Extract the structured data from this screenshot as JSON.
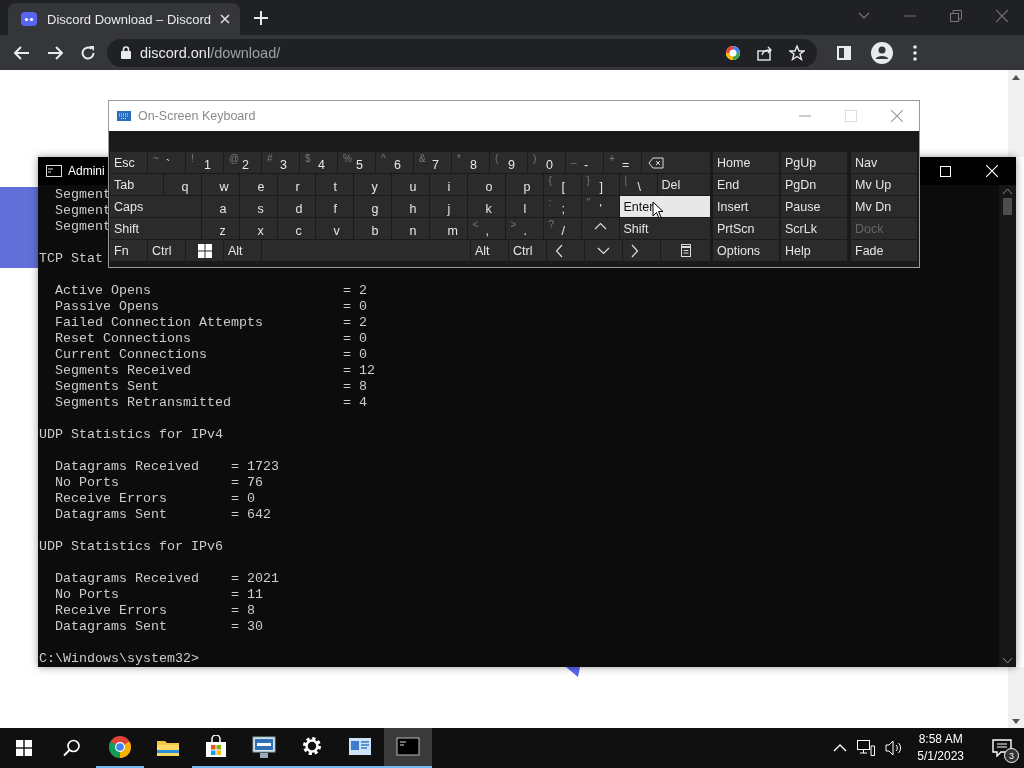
{
  "browser": {
    "tab": {
      "title": "Discord Download – Discord"
    },
    "address": {
      "host": "discord.onl",
      "path": "/download/"
    }
  },
  "console": {
    "title": "Admini",
    "blocks": [
      [
        "  Segment",
        "  Segment",
        "  Segment"
      ],
      [
        "TCP Stat"
      ],
      [
        "  Active Opens                        = 2",
        "  Passive Opens                       = 0",
        "  Failed Connection Attempts          = 2",
        "  Reset Connections                   = 0",
        "  Current Connections                 = 0",
        "  Segments Received                   = 12",
        "  Segments Sent                       = 8",
        "  Segments Retransmitted              = 4"
      ],
      [
        "UDP Statistics for IPv4"
      ],
      [
        "  Datagrams Received    = 1723",
        "  No Ports              = 76",
        "  Receive Errors        = 0",
        "  Datagrams Sent        = 642"
      ],
      [
        "UDP Statistics for IPv6"
      ],
      [
        "  Datagrams Received    = 2021",
        "  No Ports              = 11",
        "  Receive Errors        = 8",
        "  Datagrams Sent        = 30"
      ],
      [
        "C:\\Windows\\system32>"
      ]
    ]
  },
  "keyboard": {
    "title": "On-Screen Keyboard",
    "rows": [
      {
        "keys": [
          {
            "kind": "label",
            "label": "Esc",
            "hovered": false
          },
          {
            "kind": "char",
            "shift": "~",
            "label": "`",
            "hovered": false
          },
          {
            "kind": "char",
            "shift": "!",
            "label": "1",
            "hovered": false
          },
          {
            "kind": "char",
            "shift": "@",
            "label": "2",
            "hovered": false
          },
          {
            "kind": "char",
            "shift": "#",
            "label": "3",
            "hovered": false
          },
          {
            "kind": "char",
            "shift": "$",
            "label": "4",
            "hovered": false
          },
          {
            "kind": "char",
            "shift": "%",
            "label": "5",
            "hovered": false
          },
          {
            "kind": "char",
            "shift": "^",
            "label": "6",
            "hovered": false
          },
          {
            "kind": "char",
            "shift": "&",
            "label": "7",
            "hovered": false
          },
          {
            "kind": "char",
            "shift": "*",
            "label": "8",
            "hovered": false
          },
          {
            "kind": "char",
            "shift": "(",
            "label": "9",
            "hovered": false
          },
          {
            "kind": "char",
            "shift": ")",
            "label": "0",
            "hovered": false
          },
          {
            "kind": "char",
            "shift": "_",
            "label": "-",
            "hovered": false
          },
          {
            "kind": "char",
            "shift": "+",
            "label": "=",
            "hovered": false
          },
          {
            "kind": "backspace",
            "hovered": false
          }
        ]
      },
      {
        "keys": [
          {
            "kind": "wide",
            "label": "Tab",
            "hovered": false
          },
          {
            "kind": "char",
            "label": "q",
            "hovered": false
          },
          {
            "kind": "char",
            "label": "w",
            "hovered": false
          },
          {
            "kind": "char",
            "label": "e",
            "hovered": false
          },
          {
            "kind": "char",
            "label": "r",
            "hovered": false
          },
          {
            "kind": "char",
            "label": "t",
            "hovered": false
          },
          {
            "kind": "char",
            "label": "y",
            "hovered": false
          },
          {
            "kind": "char",
            "label": "u",
            "hovered": false
          },
          {
            "kind": "char",
            "label": "i",
            "hovered": false
          },
          {
            "kind": "char",
            "label": "o",
            "hovered": false
          },
          {
            "kind": "char",
            "label": "p",
            "hovered": false
          },
          {
            "kind": "char",
            "shift": "{",
            "label": "[",
            "hovered": false
          },
          {
            "kind": "char",
            "shift": "}",
            "label": "]",
            "hovered": false
          },
          {
            "kind": "char",
            "shift": "|",
            "label": "\\",
            "hovered": false
          },
          {
            "kind": "wide",
            "label": "Del",
            "hovered": false
          }
        ]
      },
      {
        "keys": [
          {
            "kind": "wide",
            "label": "Caps",
            "hovered": false
          },
          {
            "kind": "char",
            "label": "a",
            "hovered": false
          },
          {
            "kind": "char",
            "label": "s",
            "hovered": false
          },
          {
            "kind": "char",
            "label": "d",
            "hovered": false
          },
          {
            "kind": "char",
            "label": "f",
            "hovered": false
          },
          {
            "kind": "char",
            "label": "g",
            "hovered": false
          },
          {
            "kind": "char",
            "label": "h",
            "hovered": false
          },
          {
            "kind": "char",
            "label": "j",
            "hovered": false
          },
          {
            "kind": "char",
            "label": "k",
            "hovered": false
          },
          {
            "kind": "char",
            "label": "l",
            "hovered": false
          },
          {
            "kind": "char",
            "shift": ":",
            "label": ";",
            "hovered": false
          },
          {
            "kind": "char",
            "shift": "\"",
            "label": "'",
            "hovered": false
          },
          {
            "kind": "wide",
            "label": "Enter",
            "hovered": true
          }
        ]
      },
      {
        "keys": [
          {
            "kind": "wide",
            "label": "Shift",
            "hovered": false
          },
          {
            "kind": "char",
            "label": "z",
            "hovered": false
          },
          {
            "kind": "char",
            "label": "x",
            "hovered": false
          },
          {
            "kind": "char",
            "label": "c",
            "hovered": false
          },
          {
            "kind": "char",
            "label": "v",
            "hovered": false
          },
          {
            "kind": "char",
            "label": "b",
            "hovered": false
          },
          {
            "kind": "char",
            "label": "n",
            "hovered": false
          },
          {
            "kind": "char",
            "label": "m",
            "hovered": false
          },
          {
            "kind": "char",
            "shift": "<",
            "label": ",",
            "hovered": false
          },
          {
            "kind": "char",
            "shift": ">",
            "label": ".",
            "hovered": false
          },
          {
            "kind": "char",
            "shift": "?",
            "label": "/",
            "hovered": false
          },
          {
            "kind": "up",
            "hovered": false
          },
          {
            "kind": "wide",
            "label": "Shift",
            "hovered": false
          }
        ]
      },
      {
        "keys": [
          {
            "kind": "label",
            "label": "Fn",
            "hovered": false
          },
          {
            "kind": "label",
            "label": "Ctrl",
            "hovered": false
          },
          {
            "kind": "windows",
            "hovered": false
          },
          {
            "kind": "label",
            "label": "Alt",
            "hovered": false
          },
          {
            "kind": "space",
            "hovered": false
          },
          {
            "kind": "label",
            "label": "Alt",
            "hovered": false
          },
          {
            "kind": "label",
            "label": "Ctrl",
            "hovered": false
          },
          {
            "kind": "left",
            "hovered": false
          },
          {
            "kind": "down",
            "hovered": false
          },
          {
            "kind": "right",
            "hovered": false
          },
          {
            "kind": "menu",
            "hovered": false
          }
        ]
      }
    ],
    "side_rows": [
      {
        "keys": [
          {
            "label": "Home",
            "disabled": false
          },
          {
            "label": "PgUp",
            "disabled": false
          },
          {
            "label": "Nav",
            "disabled": false
          }
        ]
      },
      {
        "keys": [
          {
            "label": "End",
            "disabled": false
          },
          {
            "label": "PgDn",
            "disabled": false
          },
          {
            "label": "Mv Up",
            "disabled": false
          }
        ]
      },
      {
        "keys": [
          {
            "label": "Insert",
            "disabled": false
          },
          {
            "label": "Pause",
            "disabled": false
          },
          {
            "label": "Mv Dn",
            "disabled": false
          }
        ]
      },
      {
        "keys": [
          {
            "label": "PrtScn",
            "disabled": false
          },
          {
            "label": "ScrLk",
            "disabled": false
          },
          {
            "label": "Dock",
            "disabled": true
          }
        ]
      },
      {
        "keys": [
          {
            "label": "Options",
            "disabled": false
          },
          {
            "label": "Help",
            "disabled": false
          },
          {
            "label": "Fade",
            "disabled": false
          }
        ]
      }
    ]
  },
  "taskbar": {
    "apps": [
      {
        "kind": "chrome",
        "running": true,
        "selected": false
      },
      {
        "kind": "folder",
        "running": false,
        "selected": false
      },
      {
        "kind": "store",
        "running": true,
        "selected": false
      },
      {
        "kind": "monitor",
        "running": true,
        "selected": false
      },
      {
        "kind": "gear",
        "running": true,
        "selected": false
      },
      {
        "kind": "panel",
        "running": true,
        "selected": false
      },
      {
        "kind": "console",
        "running": true,
        "selected": true
      }
    ],
    "time": "8:58 AM",
    "date": "5/1/2023",
    "notifications": "3"
  }
}
